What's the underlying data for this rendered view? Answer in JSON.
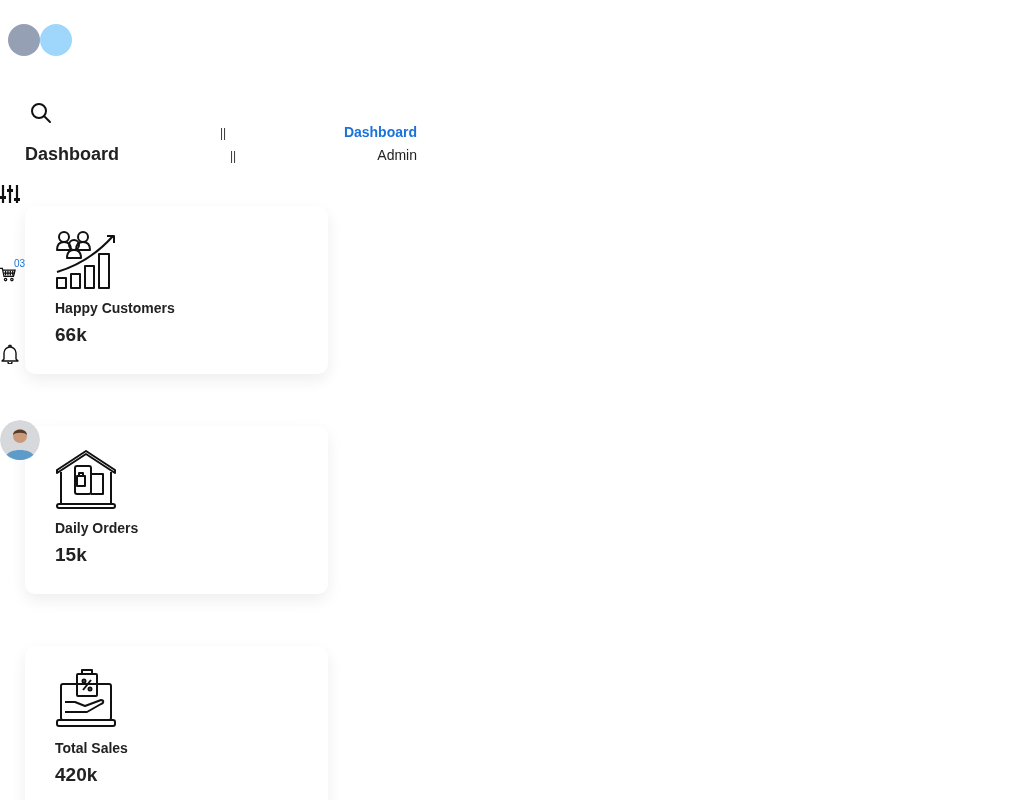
{
  "header": {
    "title": "Dashboard",
    "breadcrumbs": [
      {
        "separator": "||",
        "label": "Dashboard",
        "selected": true
      },
      {
        "separator": "||",
        "label": "Admin",
        "selected": false
      }
    ]
  },
  "cart": {
    "badge": "03"
  },
  "cards": [
    {
      "kind": "customers",
      "label": "Happy Customers",
      "value": "66k"
    },
    {
      "kind": "orders",
      "label": "Daily Orders",
      "value": "15k"
    },
    {
      "kind": "sales",
      "label": "Total Sales",
      "value": "420k"
    }
  ]
}
